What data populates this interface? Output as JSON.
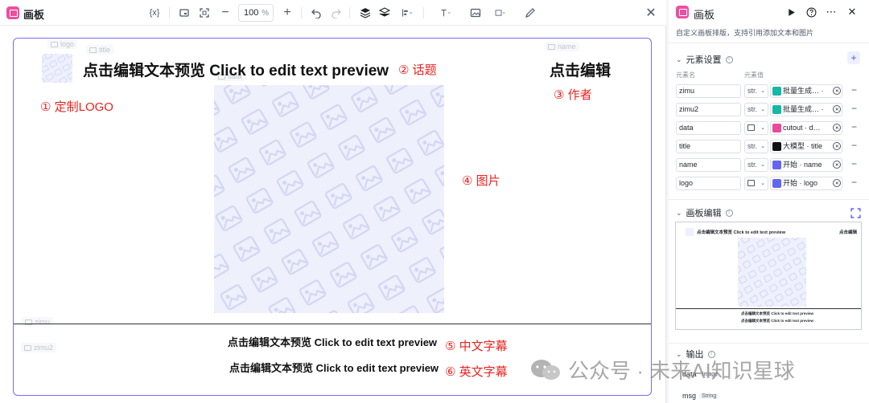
{
  "editor": {
    "title": "画板",
    "toolbar": {
      "variable_label": "{x}",
      "zoom_value": "100",
      "zoom_unit": "%"
    },
    "canvas": {
      "ghost_logo": "logo",
      "ghost_title": "title",
      "ghost_data": "data",
      "ghost_name": "name",
      "ghost_zimu": "zimu",
      "ghost_zimu2": "zimu2",
      "main_title": "点击编辑文本预览 Click to edit text preview",
      "author": "点击编辑",
      "subtitle_cn": "点击编辑文本预览 Click to edit text preview",
      "subtitle_en": "点击编辑文本预览 Click to edit text preview"
    },
    "annotations": {
      "logo": "① 定制LOGO",
      "topic": "② 话题",
      "author": "③ 作者",
      "image": "④ 图片",
      "subtitle_cn": "⑤ 中文字幕",
      "subtitle_en": "⑥ 英文字幕"
    }
  },
  "panel": {
    "title": "画板",
    "description": "自定义画板排版，支持引用添加文本和图片",
    "element_settings": {
      "title": "元素设置",
      "col_name": "元素名",
      "col_value": "元素值",
      "rows": [
        {
          "name": "zimu",
          "type": "str.",
          "value": "批量生成… ·",
          "icon_color": "#14b8a6"
        },
        {
          "name": "zimu2",
          "type": "str.",
          "value": "批量生成… ·",
          "icon_color": "#14b8a6"
        },
        {
          "name": "data",
          "type": "",
          "value": "cutout · d…",
          "icon_color": "#ec4899"
        },
        {
          "name": "title",
          "type": "str.",
          "value": "大模型 · title",
          "icon_color": "#111111"
        },
        {
          "name": "name",
          "type": "str.",
          "value": "开始 · name",
          "icon_color": "#6366f1"
        },
        {
          "name": "logo",
          "type": "",
          "value": "开始 · logo",
          "icon_color": "#6366f1"
        }
      ]
    },
    "canvas_edit": {
      "title": "画板编辑",
      "preview_title": "点击编辑文本预览 Click to edit text preview",
      "preview_author": "点击编辑",
      "preview_sub1": "点击编辑文本预览 Click to edit text preview",
      "preview_sub2": "点击编辑文本预览 Click to edit text preview"
    },
    "output": {
      "title": "输出",
      "items": [
        {
          "name": "data",
          "type": "Image"
        },
        {
          "name": "msg",
          "type": "String"
        }
      ]
    }
  },
  "watermark": "公众号 · 未来AI知识星球",
  "colors": {
    "accent": "#4d53e8",
    "canvas_border": "#7b6cf6",
    "annotation_red": "#e8231f",
    "app_icon": "#ee4ea0",
    "placeholder_bg": "#eef0fc"
  }
}
